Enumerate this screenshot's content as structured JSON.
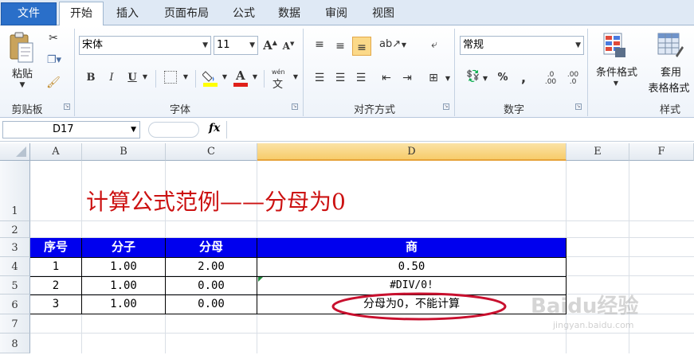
{
  "tabs": {
    "file": "文件",
    "items": [
      "开始",
      "插入",
      "页面布局",
      "公式",
      "数据",
      "审阅",
      "视图"
    ],
    "active": "开始"
  },
  "ribbon": {
    "clipboard": {
      "paste": "粘贴",
      "group_label": "剪贴板"
    },
    "font": {
      "name": "宋体",
      "size": "11",
      "bold": "B",
      "italic": "I",
      "underline": "U",
      "grow": "A",
      "shrink": "A",
      "color_a": "A",
      "phonetic": "wén",
      "group_label": "字体"
    },
    "alignment": {
      "group_label": "对齐方式"
    },
    "number": {
      "format": "常规",
      "percent": "%",
      "comma": ",",
      "group_label": "数字"
    },
    "styles": {
      "conditional": "条件格式",
      "table_line1": "套用",
      "table_line2": "表格格式",
      "group_label": "样式"
    }
  },
  "formula_bar": {
    "name_box": "D17",
    "fx": "fx",
    "formula": ""
  },
  "sheet": {
    "columns": [
      "A",
      "B",
      "C",
      "D",
      "E",
      "F"
    ],
    "selected_column": "D",
    "rows": [
      "1",
      "2",
      "3",
      "4",
      "5",
      "6",
      "7",
      "8"
    ],
    "title": "计算公式范例——分母为0",
    "header": [
      "序号",
      "分子",
      "分母",
      "商"
    ],
    "data": [
      [
        "1",
        "1.00",
        "2.00",
        "0.50"
      ],
      [
        "2",
        "1.00",
        "0.00",
        "#DIV/0!"
      ],
      [
        "3",
        "1.00",
        "0.00",
        "分母为0，不能计算"
      ]
    ]
  },
  "watermark": {
    "brand": "Baidu经验",
    "url": "jingyan.baidu.com"
  },
  "colors": {
    "title_red": "#cc1111",
    "header_blue": "#0000ee",
    "annotation_red": "#c8102e",
    "file_tab": "#2a6fc9"
  }
}
